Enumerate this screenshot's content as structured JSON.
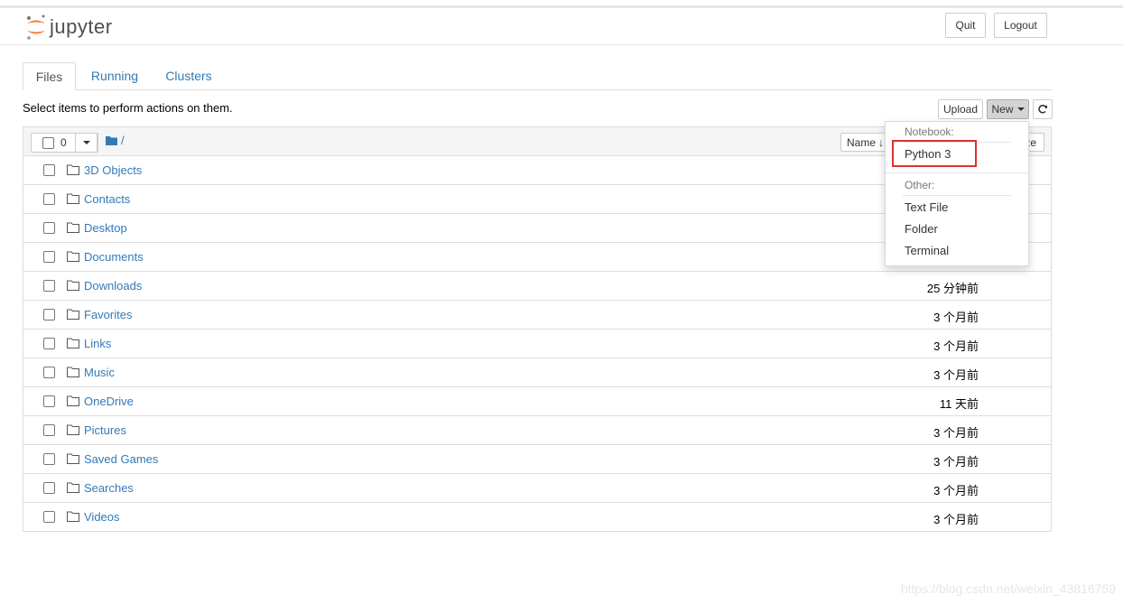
{
  "header": {
    "logo_text": "jupyter",
    "quit_label": "Quit",
    "logout_label": "Logout"
  },
  "tabs": [
    {
      "label": "Files"
    },
    {
      "label": "Running"
    },
    {
      "label": "Clusters"
    }
  ],
  "toolbar": {
    "hint": "Select items to perform actions on them.",
    "upload_label": "Upload",
    "new_label": "New",
    "selected_count": "0",
    "breadcrumb_path": "/",
    "sort_name_label": "Name",
    "size_label_partial": "ze"
  },
  "files": [
    {
      "name": "3D Objects",
      "time": ""
    },
    {
      "name": "Contacts",
      "time": ""
    },
    {
      "name": "Desktop",
      "time": ""
    },
    {
      "name": "Documents",
      "time": ""
    },
    {
      "name": "Downloads",
      "time": "25 分钟前"
    },
    {
      "name": "Favorites",
      "time": "3 个月前"
    },
    {
      "name": "Links",
      "time": "3 个月前"
    },
    {
      "name": "Music",
      "time": "3 个月前"
    },
    {
      "name": "OneDrive",
      "time": "11 天前"
    },
    {
      "name": "Pictures",
      "time": "3 个月前"
    },
    {
      "name": "Saved Games",
      "time": "3 个月前"
    },
    {
      "name": "Searches",
      "time": "3 个月前"
    },
    {
      "name": "Videos",
      "time": "3 个月前"
    }
  ],
  "new_menu": {
    "notebook_header": "Notebook:",
    "python3": "Python 3",
    "other_header": "Other:",
    "text_file": "Text File",
    "folder": "Folder",
    "terminal": "Terminal"
  },
  "watermark": "https://blog.csdn.net/weixin_43816759",
  "colors": {
    "link": "#337ab7",
    "logo_orange": "#f37726",
    "highlight_red": "#e0312e"
  }
}
